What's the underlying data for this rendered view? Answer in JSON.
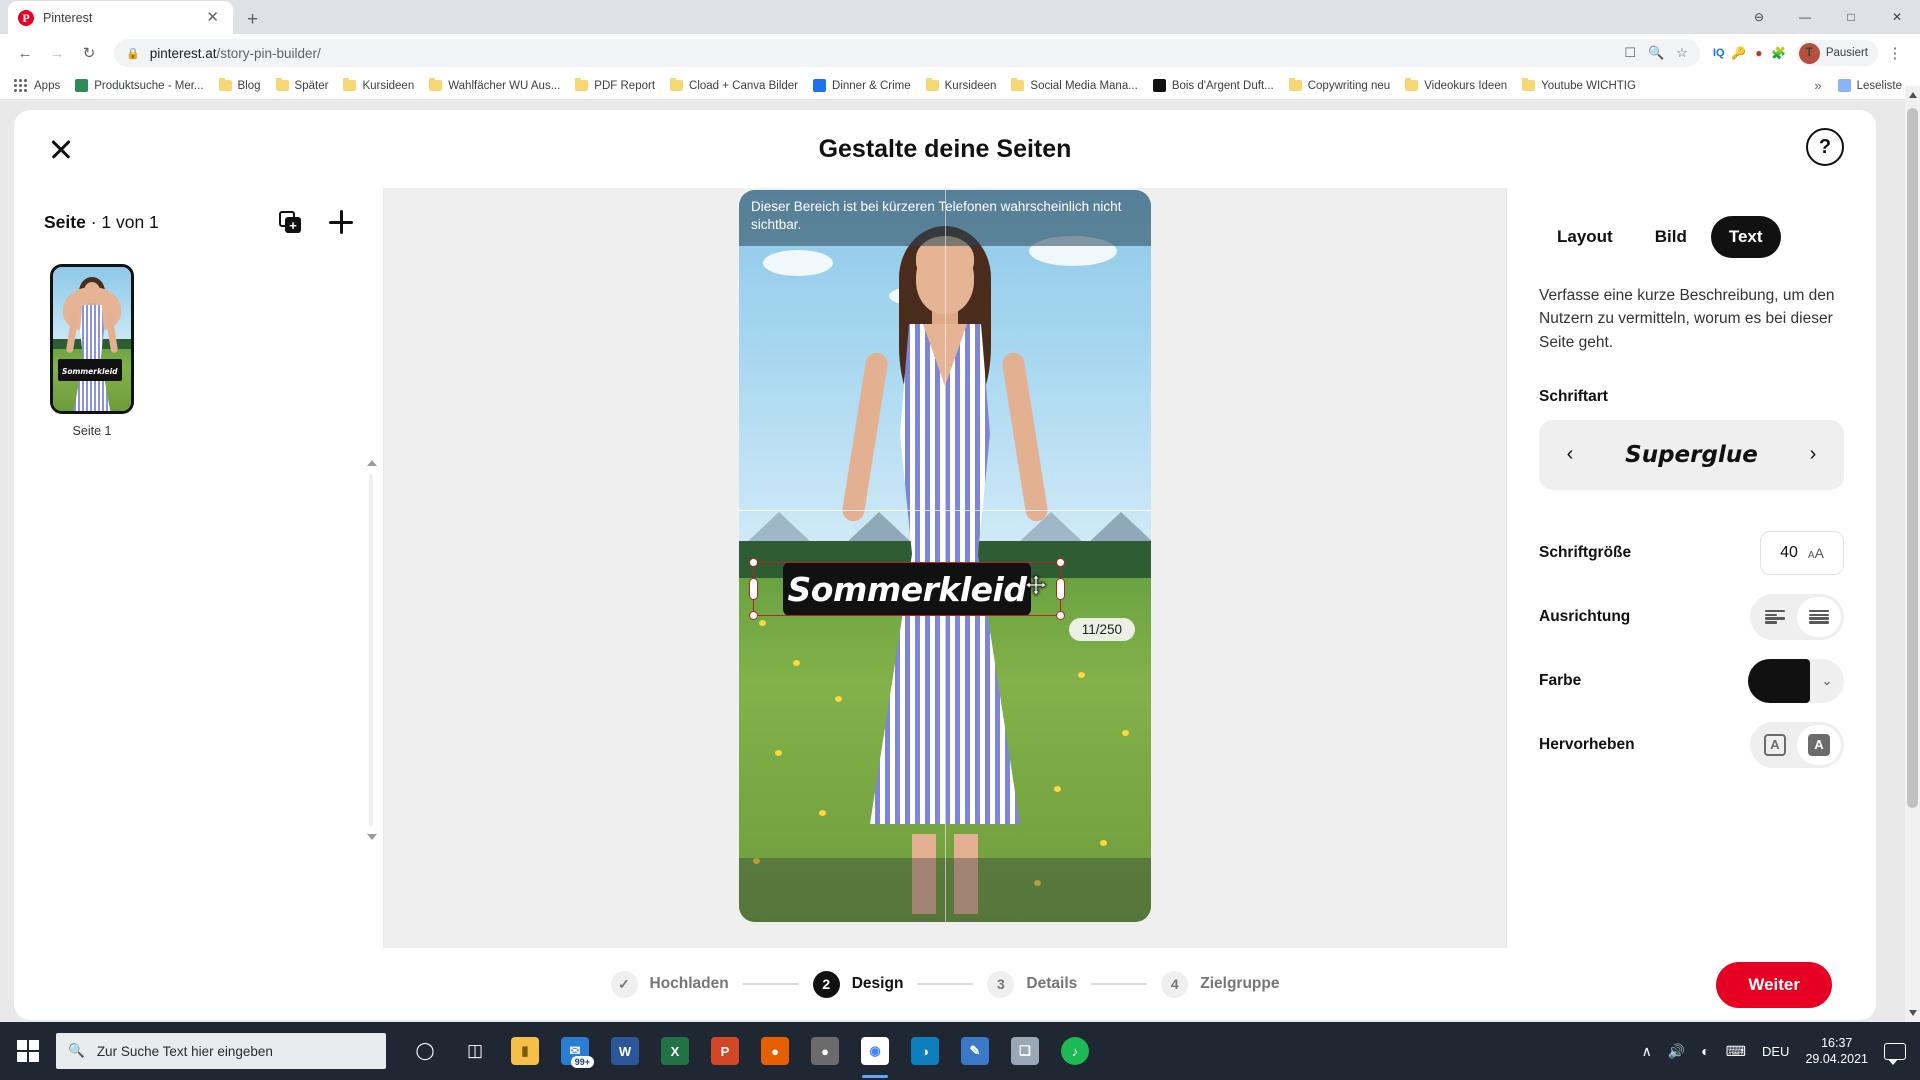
{
  "browser": {
    "tab": {
      "title": "Pinterest",
      "favicon": "pinterest-icon",
      "close": "✕"
    },
    "new_tab": "+",
    "window_controls": {
      "minimize": "—",
      "maximize": "□",
      "close": "✕",
      "extra": "⊖"
    },
    "nav": {
      "back": "←",
      "forward": "→",
      "reload": "↻"
    },
    "omnibox": {
      "lock": "🔒",
      "domain": "pinterest.at",
      "path": "/story-pin-builder/",
      "icons": [
        "cast-icon",
        "zoom-icon",
        "star-icon"
      ]
    },
    "extensions": [
      "IQ",
      "key-icon",
      "shield-icon",
      "puzzle-icon"
    ],
    "profile": {
      "initial": "T",
      "label": "Pausiert"
    },
    "menu": "⋮",
    "bookmarks": [
      {
        "label": "Apps",
        "icon": "apps-grid-icon"
      },
      {
        "label": "Produktsuche - Mer...",
        "icon": "site-icon",
        "color": "#2e8b57"
      },
      {
        "label": "Blog",
        "icon": "folder-icon"
      },
      {
        "label": "Später",
        "icon": "folder-icon"
      },
      {
        "label": "Kursideen",
        "icon": "folder-icon"
      },
      {
        "label": "Wahlfächer WU Aus...",
        "icon": "folder-icon"
      },
      {
        "label": "PDF Report",
        "icon": "folder-icon"
      },
      {
        "label": "Cload + Canva Bilder",
        "icon": "folder-icon"
      },
      {
        "label": "Dinner & Crime",
        "icon": "site-icon",
        "color": "#1a73e8"
      },
      {
        "label": "Kursideen",
        "icon": "folder-icon"
      },
      {
        "label": "Social Media Mana...",
        "icon": "folder-icon"
      },
      {
        "label": "Bois d'Argent Duft...",
        "icon": "site-icon",
        "color": "#111111"
      },
      {
        "label": "Copywriting neu",
        "icon": "folder-icon"
      },
      {
        "label": "Videokurs Ideen",
        "icon": "folder-icon"
      },
      {
        "label": "Youtube WICHTIG",
        "icon": "folder-icon"
      }
    ],
    "bookmarks_overflow": "»",
    "reading_list": {
      "label": "Leseliste",
      "icon": "reading-list-icon"
    }
  },
  "modal": {
    "title": "Gestalte deine Seiten",
    "close_icon": "close-icon",
    "help_icon": "help-icon",
    "pages": {
      "heading_bold": "Seite",
      "heading_rest": " · 1 von 1",
      "duplicate_icon": "duplicate-page-icon",
      "add_icon": "add-page-icon",
      "thumbnails": [
        {
          "label": "Seite 1",
          "overlay_text": "Sommerkleid"
        }
      ]
    },
    "canvas": {
      "safe_area_note": "Dieser Bereich ist bei kürzeren Telefonen wahrscheinlich nicht sichtbar.",
      "text_element": "Sommerkleid",
      "char_counter": "11/250",
      "delete_icon": "trash-icon",
      "move_cursor": "move-cursor-icon"
    },
    "options": {
      "tabs": [
        {
          "label": "Layout",
          "active": false
        },
        {
          "label": "Bild",
          "active": false
        },
        {
          "label": "Text",
          "active": true
        }
      ],
      "description": "Verfasse eine kurze Beschreibung, um den Nutzern zu vermitteln, worum es bei dieser Seite geht.",
      "font_label": "Schriftart",
      "font_value": "Superglue",
      "font_prev": "‹",
      "font_next": "›",
      "size_label": "Schriftgröße",
      "size_value": "40",
      "size_icon": "font-size-icon",
      "align_label": "Ausrichtung",
      "align_options": [
        {
          "name": "align-left",
          "selected": false
        },
        {
          "name": "align-center",
          "selected": true
        }
      ],
      "color_label": "Farbe",
      "color_value": "#111111",
      "color_chevron": "⌄",
      "highlight_label": "Hervorheben",
      "highlight_options": [
        {
          "name": "highlight-outline",
          "glyph": "A",
          "selected": false
        },
        {
          "name": "highlight-filled",
          "glyph": "A",
          "selected": true
        }
      ]
    },
    "footer": {
      "steps": [
        {
          "badge": "✓",
          "label": "Hochladen",
          "state": "done"
        },
        {
          "badge": "2",
          "label": "Design",
          "state": "current"
        },
        {
          "badge": "3",
          "label": "Details",
          "state": "todo"
        },
        {
          "badge": "4",
          "label": "Zielgruppe",
          "state": "todo"
        }
      ],
      "next_button": "Weiter"
    }
  },
  "taskbar": {
    "start_icon": "windows-start-icon",
    "search_placeholder": "Zur Suche Text hier eingeben",
    "search_icon": "search-icon",
    "cortana_icon": "cortana-icon",
    "taskview_icon": "task-view-icon",
    "apps": [
      {
        "name": "file-explorer-icon",
        "glyph": "📁",
        "color": "#f5c04a"
      },
      {
        "name": "mail-icon",
        "glyph": "✉",
        "color": "#2b7cd3",
        "badge": "99+"
      },
      {
        "name": "word-icon",
        "glyph": "W",
        "color": "#2b579a"
      },
      {
        "name": "excel-icon",
        "glyph": "X",
        "color": "#217346"
      },
      {
        "name": "powerpoint-icon",
        "glyph": "P",
        "color": "#d24726"
      },
      {
        "name": "firefox-icon",
        "glyph": "●",
        "color": "#e66000"
      },
      {
        "name": "browser-icon",
        "glyph": "●",
        "color": "#6b6b6b"
      },
      {
        "name": "chrome-icon",
        "glyph": "◉",
        "color": "#4285f4",
        "active": true
      },
      {
        "name": "edge-icon",
        "glyph": "◑",
        "color": "#0d7ebd"
      },
      {
        "name": "editor-icon",
        "glyph": "✒",
        "color": "#3b78c7"
      },
      {
        "name": "photos-icon",
        "glyph": "❑",
        "color": "#9aa7b4"
      },
      {
        "name": "spotify-icon",
        "glyph": "♫",
        "color": "#1db954"
      }
    ],
    "tray": {
      "chevron": "∧",
      "volume_icon": "volume-icon",
      "network_icon": "wifi-icon",
      "keyboard_icon": "keyboard-icon",
      "language": "DEU",
      "time": "16:37",
      "date": "29.04.2021",
      "notifications_icon": "notification-icon"
    }
  }
}
